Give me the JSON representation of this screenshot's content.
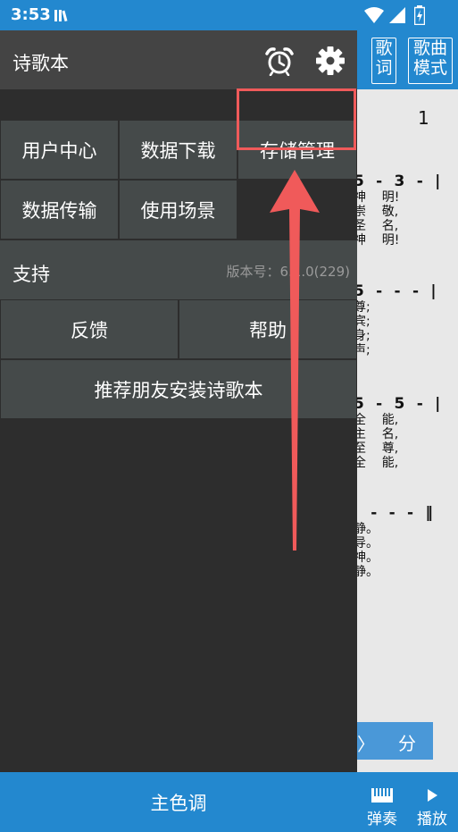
{
  "status_bar": {
    "time": "3:53",
    "icons": [
      "app-notification-icon",
      "wifi-icon",
      "signal-icon",
      "battery-charging-icon"
    ]
  },
  "drawer": {
    "title": "诗歌本",
    "header_icons": [
      "alarm-clock-icon",
      "gear-icon"
    ],
    "grid_buttons": {
      "user_center": "用户中心",
      "data_download": "数据下载",
      "storage_management": "存储管理",
      "data_transfer": "数据传输",
      "usage_scene": "使用场景"
    },
    "support": {
      "label": "支持",
      "version": "版本号：6.1.0(229)"
    },
    "feedback": "反馈",
    "help": "帮助",
    "recommend": "推荐朋友安装诗歌本",
    "theme_color": "主色调"
  },
  "song_page": {
    "lyrics_button": "歌\n词",
    "score_mode_button": "歌曲\n模式",
    "page_number": "1",
    "blocks": [
      {
        "notes": "5  -  3  -  |",
        "lyrics": [
          "神    明!",
          "崇    敬,",
          "圣    名,",
          "神    明!"
        ]
      },
      {
        "notes": "5  -  -  -  |",
        "lyrics": [
          "尊;",
          "宾;",
          "身;",
          "声;"
        ]
      },
      {
        "notes": "5  -  5  -  |",
        "lyrics": [
          "全    能,",
          "主    名,",
          "至    尊,",
          "全    能,"
        ]
      },
      {
        "notes": "   -  -  -  ‖",
        "lyrics": [
          "静。",
          "导。",
          "神。",
          "静。"
        ]
      }
    ],
    "nav_arrow": "〉",
    "nav_label": "分",
    "play_bar": {
      "play_keyboard": "弹奏",
      "play": "播放"
    }
  },
  "colors": {
    "accent_blue": "#2388cf",
    "drawer_button": "#454a4a",
    "drawer_background": "#2d2d2d",
    "highlight_red": "#f05a5a"
  }
}
